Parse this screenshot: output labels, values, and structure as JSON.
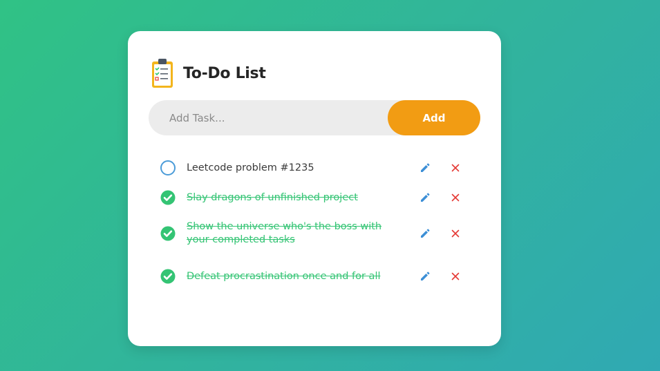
{
  "app": {
    "title": "To-Do List",
    "icon": "clipboard-checklist-icon"
  },
  "input": {
    "placeholder": "Add Task...",
    "value": "",
    "add_label": "Add"
  },
  "colors": {
    "accent": "#f29c13",
    "done_text": "#34c474",
    "pending_circle": "#4a9bd8",
    "edit_icon": "#3d8fd6",
    "delete_icon": "#e53935"
  },
  "tasks": [
    {
      "text": "Leetcode problem #1235",
      "completed": false
    },
    {
      "text": "Slay dragons of unfinished project",
      "completed": true
    },
    {
      "text": "Show the universe who's the boss with your completed tasks",
      "completed": true
    },
    {
      "text": "Defeat procrastination once and for all",
      "completed": true
    }
  ]
}
